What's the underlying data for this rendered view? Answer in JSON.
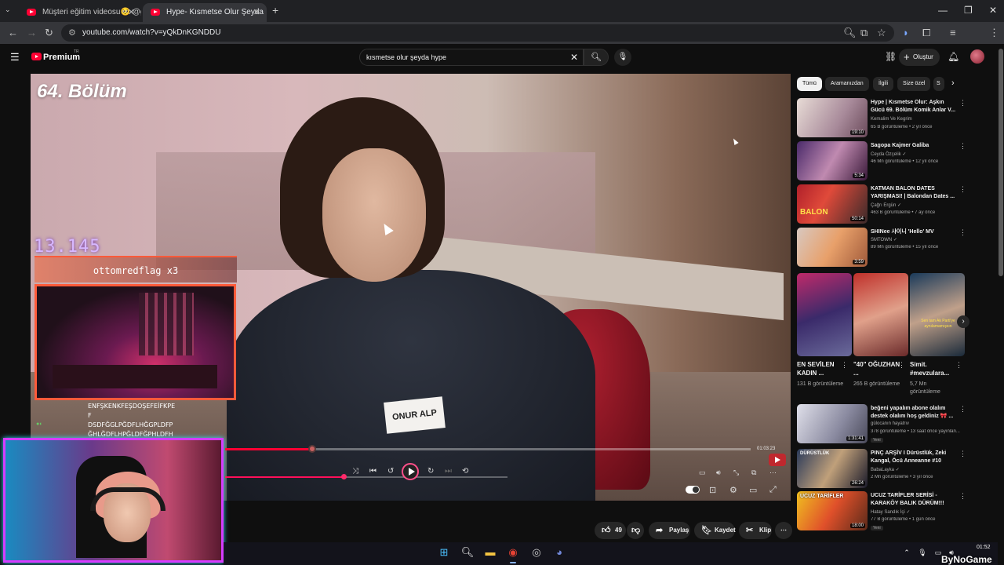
{
  "browser": {
    "tabs": [
      {
        "label": "Müşteri eğitim videosu🥺 @gu",
        "active": false
      },
      {
        "label": "Hype- Kısmetse Olur Şeyda",
        "active": true
      }
    ],
    "new_tab": "+",
    "url": "youtube.com/watch?v=yQkDnKGNDDU"
  },
  "youtube": {
    "logo": "Premium",
    "logo_region": "TR",
    "search_query": "kısmetse olur şeyda hype",
    "create_label": "Oluştur"
  },
  "video": {
    "episode_overlay": "64. Bölüm",
    "name_tag": "ONUR ALP",
    "time_total": "01:03:23",
    "progress": 0.166
  },
  "stream_overlay": {
    "counter": "13.145",
    "goal_label": "ottomredflag x3",
    "chat_lines": [
      "ENFŞKENKFEŞDOŞEFEİFKPE",
      "F",
      "DSDFĞGLPĞDFLHĞGPLDFP",
      "ĞHLĞDFLHPĞLDFĞPHLDFH"
    ]
  },
  "actions": {
    "likes": "49",
    "share": "Paylaş",
    "save": "Kaydet",
    "clip": "Klip"
  },
  "sidebar": {
    "chips": [
      "Tümü",
      "Aramanızdan",
      "İlgili",
      "Size özel",
      "S"
    ],
    "videos": [
      {
        "title": "Hype | Kısmetse Olur: Aşkın Gücü 69. Bölüm Komik Anlar V...",
        "channel": "Kemalim Ve Kegrim",
        "meta": "65 B görüntüleme • 2 yıl önce",
        "duration": "19:10"
      },
      {
        "title": "Sagopa Kajmer Galiba",
        "channel": "Ceyda Özçelik ✓",
        "meta": "46 Mn görüntüleme • 12 yıl önce",
        "duration": "5:34"
      },
      {
        "title": "KATMAN BALON DATES YARIŞMASI! | Balondan Dates ...",
        "channel": "Çağrı Ergün ✓",
        "meta": "463 B görüntüleme • 7 ay önce",
        "duration": "50:14"
      },
      {
        "title": "SHINee 샤이니 'Hello' MV",
        "channel": "SMTOWN ✓",
        "meta": "89 Mn görüntüleme • 15 yıl önce",
        "duration": "3:59"
      }
    ],
    "shorts": [
      {
        "title": "EN SEVİLEN KADIN ...",
        "views": "131 B görüntüleme"
      },
      {
        "title": "\"40\" OĞUZHAN ...",
        "views": "265 B görüntüleme"
      },
      {
        "title": "Simit. #mevzulara...",
        "views": "5,7 Mn görüntüleme"
      }
    ],
    "short_caption": "Sen tam Ak Parti'ye aynılamamışsın",
    "more_videos": [
      {
        "title": "beğeni yapalım abone olalım destek olalım hoş geldiniz 🎀 ...",
        "channel": "gülocanın hayatrıv",
        "meta": "378 görüntüleme • 13 saat önce yayınlan...",
        "duration": "1:31:41",
        "badge": "Yeni"
      },
      {
        "title": "PINÇ ARŞİV I Dürüstlük, Zeki Kangal, Öcü Anneanne #10",
        "channel": "BabaLayka ✓",
        "meta": "2 Mn görüntüleme • 3 yıl önce",
        "duration": "26:24",
        "thumb_text": "DÜRÜSTLÜK"
      },
      {
        "title": "UCUZ TARİFLER SERİSİ - KARAKÖY BALIK DÜRÜM!!!",
        "channel": "Hatay Sandık İçi ✓",
        "meta": "77 B görüntüleme • 1 gün önce",
        "duration": "18:00",
        "badge": "Yeni",
        "thumb_text": "UCUZ TARİFLER"
      }
    ]
  },
  "taskbar": {
    "time": "01:52",
    "watermark": "ByNoGame"
  },
  "colors": {
    "yt_red": "#ff0033",
    "accent_pink": "#ff4f8a",
    "webcam_border": "#d63cff"
  }
}
